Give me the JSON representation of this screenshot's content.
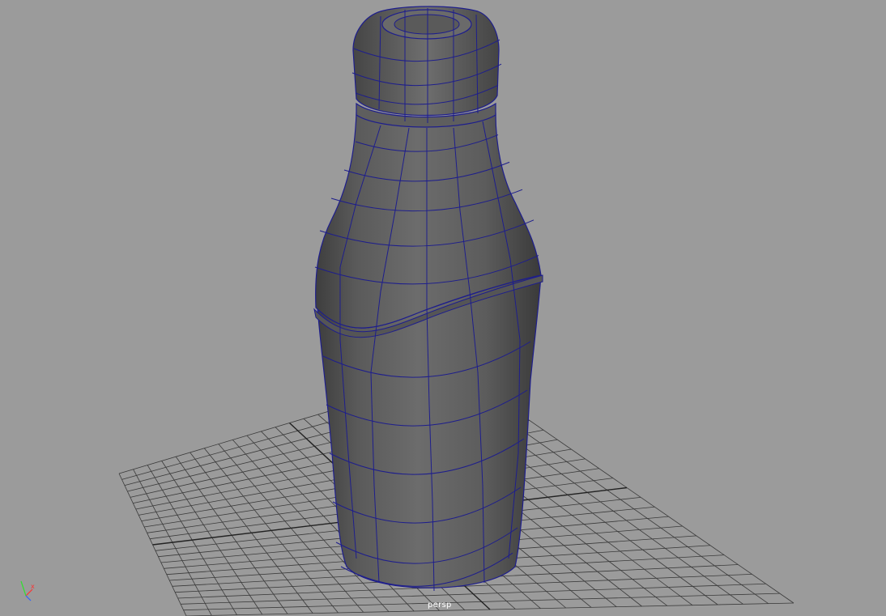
{
  "viewport": {
    "camera": "persp",
    "background_color": "#9b9b9b",
    "grid_color": "#3a3a3a",
    "wireframe_color": "#1e1e8c",
    "model": "bottle-mesh"
  },
  "axis_indicator": {
    "x_color": "#ff3030",
    "y_color": "#30e030",
    "z_color": "#3060ff"
  }
}
